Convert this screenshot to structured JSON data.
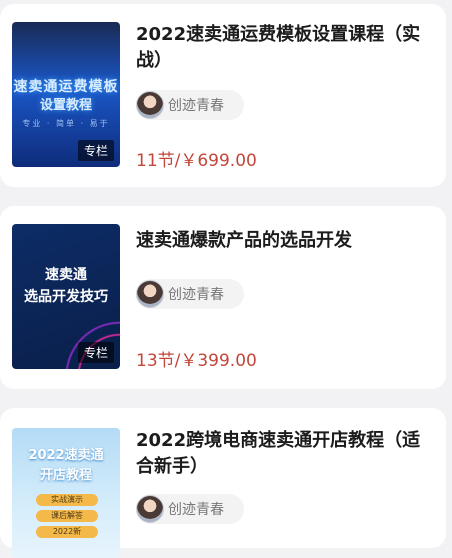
{
  "courses": [
    {
      "title": "2022速卖通运费模板设置课程（实战）",
      "author": "创迹青春",
      "price": "11节/￥699.00",
      "thumb_line1": "速卖通运费模板",
      "thumb_line2": "设置教程",
      "thumb_line3": "专业 · 简单 · 易于",
      "tag": "专栏"
    },
    {
      "title": "速卖通爆款产品的选品开发",
      "author": "创迹青春",
      "price": "13节/￥399.00",
      "thumb_line1": "速卖通",
      "thumb_line2": "选品开发技巧",
      "tag": "专栏"
    },
    {
      "title": "2022跨境电商速卖通开店教程（适合新手）",
      "author": "创迹青春",
      "thumb_line1": "2022速卖通",
      "thumb_line2": "开店教程",
      "pill1": "实战演示",
      "pill2": "课后解答",
      "pill3": "2022新"
    }
  ],
  "colors": {
    "background": "#f2f2f4",
    "card": "#ffffff",
    "price": "#c2473a",
    "title": "#1c1c1c"
  }
}
